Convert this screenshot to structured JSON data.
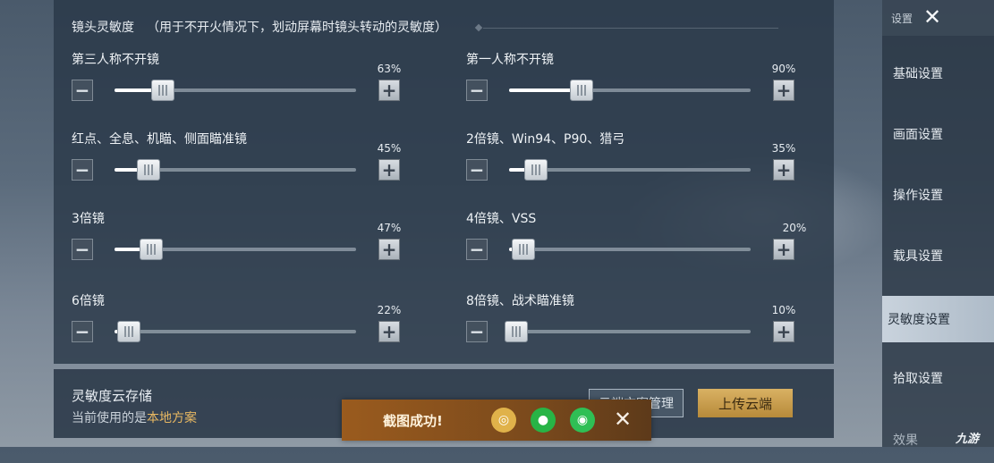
{
  "header": {
    "title": "镜头灵敏度",
    "subtitle": "（用于不开火情况下，划动屏幕时镜头转动的灵敏度）"
  },
  "sliders": [
    {
      "label": "第三人称不开镜",
      "percent": "63%",
      "value": 0.2
    },
    {
      "label": "第一人称不开镜",
      "percent": "90%",
      "value": 0.3
    },
    {
      "label": "红点、全息、机瞄、侧面瞄准镜",
      "percent": "45%",
      "value": 0.14
    },
    {
      "label": "2倍镜、Win94、P90、猎弓",
      "percent": "35%",
      "value": 0.11
    },
    {
      "label": "3倍镜",
      "percent": "47%",
      "value": 0.15
    },
    {
      "label": "4倍镜、VSS",
      "percent": "20%",
      "value": 0.06
    },
    {
      "label": "6倍镜",
      "percent": "22%",
      "value": 0.06
    },
    {
      "label": "8倍镜、战术瞄准镜",
      "percent": "10%",
      "value": 0.03
    }
  ],
  "buttons": {
    "minus": "−",
    "plus": "+"
  },
  "sidebar": {
    "top_label": "设置",
    "close": "✕",
    "items": [
      {
        "label": "基础设置"
      },
      {
        "label": "画面设置"
      },
      {
        "label": "操作设置"
      },
      {
        "label": "载具设置"
      },
      {
        "label": "灵敏度设置"
      },
      {
        "label": "拾取设置"
      },
      {
        "label": "效果"
      }
    ]
  },
  "cloud": {
    "title": "灵敏度云存储",
    "current_prefix": "当前使用的是",
    "current_value": "本地方案",
    "manage_label": "云端方案管理",
    "upload_label": "上传云端"
  },
  "toast": {
    "message": "截图成功!",
    "close": "✕"
  },
  "watermark": "九游"
}
